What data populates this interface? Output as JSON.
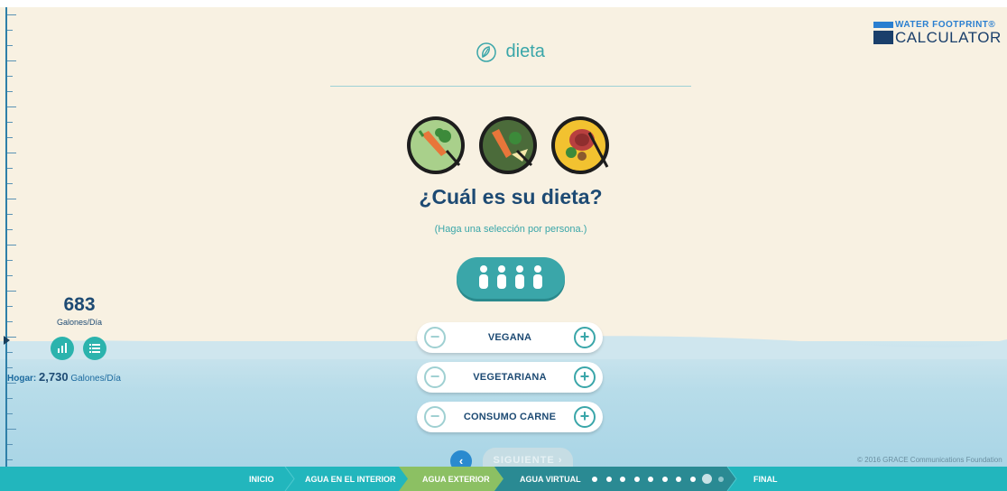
{
  "header": {
    "section_title": "dieta",
    "section_icon": "diet-leaf-icon"
  },
  "logo": {
    "line1": "WATER FOOTPRINT®",
    "line2": "CALCULATOR"
  },
  "question": {
    "title": "¿Cuál es su dieta?",
    "hint": "(Haga una selección por persona.)",
    "people_count": 4
  },
  "options": [
    {
      "label": "VEGANA",
      "minus": "−",
      "plus": "+"
    },
    {
      "label": "VEGETARIANA",
      "minus": "−",
      "plus": "+"
    },
    {
      "label": "CONSUMO CARNE",
      "minus": "−",
      "plus": "+"
    }
  ],
  "stats": {
    "personal_value": "683",
    "personal_unit": "Galones/Día",
    "household_label": "Hogar:",
    "household_value": "2,730",
    "household_unit": "Galones/Día"
  },
  "nav": {
    "back": "‹",
    "next": "SIGUIENTE  ›"
  },
  "footer": {
    "copyright": "© 2016 GRACE Communications Foundation"
  },
  "progress": {
    "steps": [
      {
        "label": "INICIO"
      },
      {
        "label": "AGUA EN EL INTERIOR"
      },
      {
        "label": "AGUA EXTERIOR"
      },
      {
        "label": "AGUA VIRTUAL"
      },
      {
        "label": "FINAL"
      }
    ],
    "virtual_substeps_total": 10,
    "virtual_substeps_current": 9
  },
  "colors": {
    "teal": "#3aa6a9",
    "navy": "#1d4a73",
    "active_step": "#8cc063",
    "progress_bar": "#22b6bd",
    "virtual_step": "#2a8a93"
  }
}
